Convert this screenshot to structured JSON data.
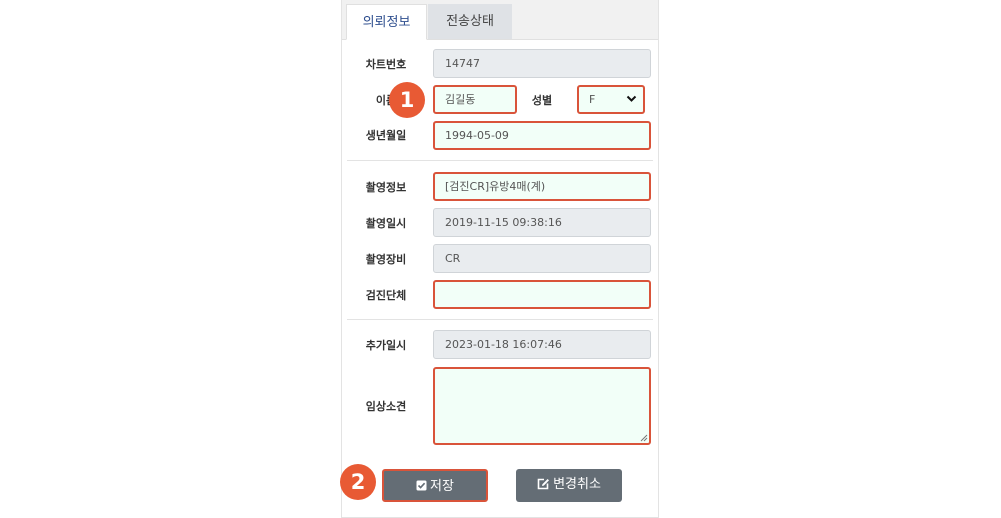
{
  "tabs": [
    {
      "label": "의뢰정보"
    },
    {
      "label": "전송상태"
    }
  ],
  "form": {
    "chart_no_label": "차트번호",
    "chart_no_value": "14747",
    "name_label": "이름",
    "name_value": "김길동",
    "gender_label": "성별",
    "gender_value": "F",
    "birth_label": "생년월일",
    "birth_value": "1994-05-09",
    "exam_info_label": "촬영정보",
    "exam_info_value": "[검진CR]유방4매(계)",
    "exam_datetime_label": "촬영일시",
    "exam_datetime_value": "2019-11-15 09:38:16",
    "equipment_label": "촬영장비",
    "equipment_value": "CR",
    "group_label": "검진단체",
    "group_value": "",
    "added_datetime_label": "추가일시",
    "added_datetime_value": "2023-01-18 16:07:46",
    "clinical_label": "임상소견",
    "clinical_value": ""
  },
  "buttons": {
    "save_label": "저장",
    "cancel_label": "변경취소"
  },
  "callouts": [
    "1",
    "2"
  ],
  "colors": {
    "highlight": "#d9543a",
    "callout": "#e85a34",
    "button": "#646d75",
    "editable_bg": "#f2fff8",
    "readonly_bg": "#e9ecef"
  }
}
